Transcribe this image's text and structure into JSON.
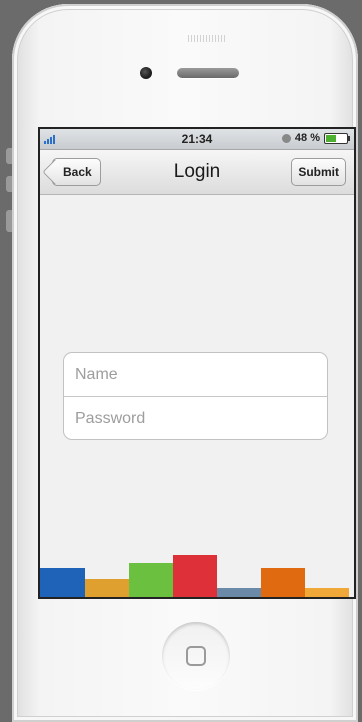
{
  "status_bar": {
    "time": "21:34",
    "battery_percent": "48 %",
    "battery_level": 0.48,
    "signal_bars": 4
  },
  "nav": {
    "title": "Login",
    "back_label": "Back",
    "submit_label": "Submit"
  },
  "form": {
    "name_placeholder": "Name",
    "password_placeholder": "Password"
  },
  "color_bars": [
    {
      "color": "#1e63b8",
      "height": 0.55
    },
    {
      "color": "#e0a030",
      "height": 0.37
    },
    {
      "color": "#6cc040",
      "height": 0.63
    },
    {
      "color": "#dd3038",
      "height": 0.77
    },
    {
      "color": "#6a8aa8",
      "height": 0.22
    },
    {
      "color": "#e06a10",
      "height": 0.55
    },
    {
      "color": "#f0a838",
      "height": 0.22
    }
  ],
  "icons": [
    "signal-icon",
    "lock-icon",
    "battery-icon",
    "back-chevron-icon",
    "home-button-icon",
    "camera-icon",
    "speaker-icon"
  ]
}
